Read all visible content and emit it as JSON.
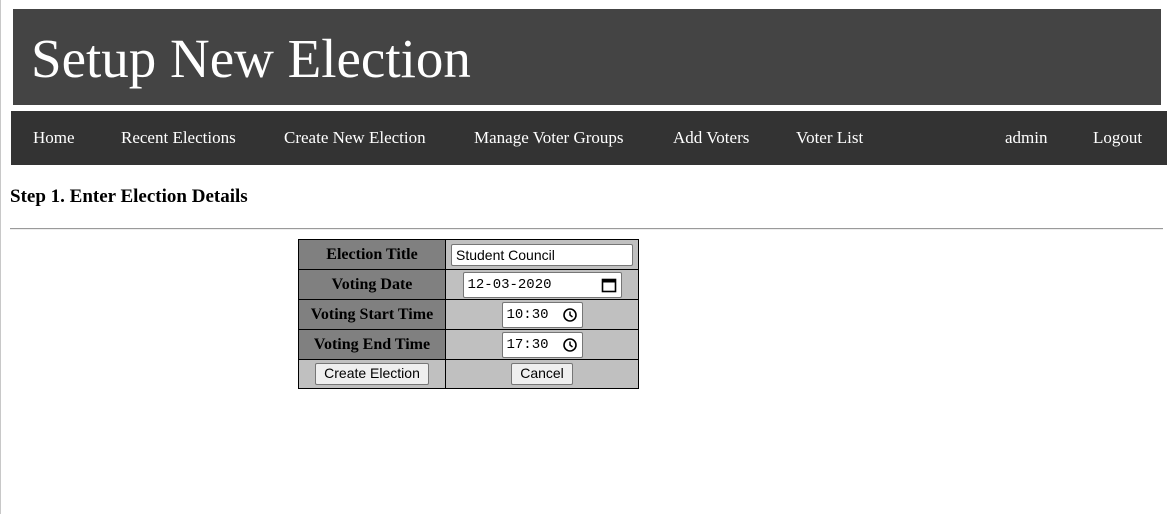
{
  "header": {
    "title": "Setup New Election"
  },
  "nav": {
    "items": [
      {
        "label": "Home"
      },
      {
        "label": "Recent Elections"
      },
      {
        "label": "Create New Election"
      },
      {
        "label": "Manage Voter Groups"
      },
      {
        "label": "Add Voters"
      },
      {
        "label": "Voter List"
      }
    ],
    "user": "admin",
    "logout": "Logout"
  },
  "step": {
    "heading": "Step 1. Enter Election Details"
  },
  "form": {
    "title_label": "Election Title",
    "title_value": "Student Council",
    "date_label": "Voting Date",
    "date_value": "12-03-2020",
    "start_label": "Voting Start Time",
    "start_value": "10:30",
    "end_label": "Voting End Time",
    "end_value": "17:30",
    "create_button": "Create Election",
    "cancel_button": "Cancel"
  },
  "icons": {
    "date": "calendar-icon",
    "time": "clock-icon"
  },
  "colors": {
    "header_bg": "#444444",
    "nav_bg": "#333333",
    "label_cell_bg": "#808080",
    "value_cell_bg": "#c0c0c0"
  }
}
